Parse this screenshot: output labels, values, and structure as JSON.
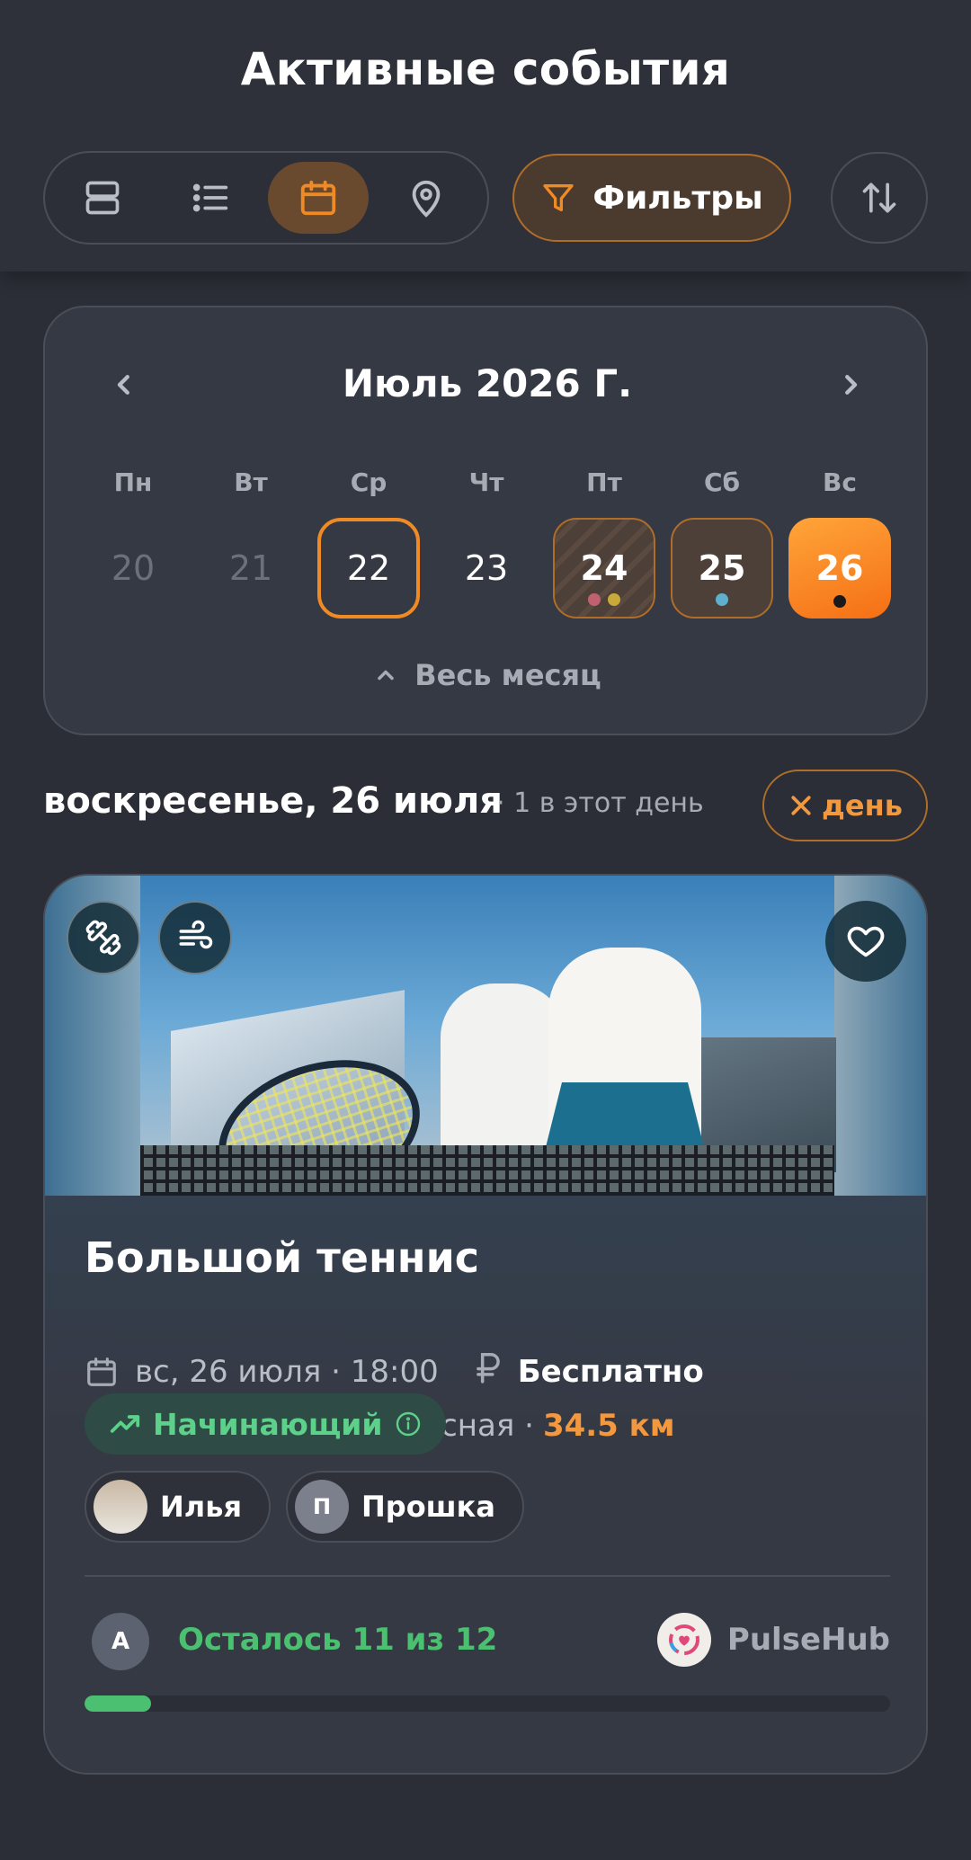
{
  "header": {
    "title": "Активные события",
    "views": [
      "cards-view-icon",
      "list-view-icon",
      "calendar-view-icon",
      "map-view-icon"
    ],
    "active_view": "calendar",
    "filters_label": "Фильтры",
    "accent_color": "#f08a24"
  },
  "calendar": {
    "month_label": "Июль 2026 Г.",
    "weekdays": [
      "Пн",
      "Вт",
      "Ср",
      "Чт",
      "Пт",
      "Сб",
      "Вс"
    ],
    "days": [
      {
        "label": "20",
        "state": "past"
      },
      {
        "label": "21",
        "state": "past"
      },
      {
        "label": "22",
        "state": "today"
      },
      {
        "label": "23",
        "state": "normal"
      },
      {
        "label": "24",
        "state": "has-events",
        "dots": [
          "#c0616f",
          "#c9a93a"
        ]
      },
      {
        "label": "25",
        "state": "has-events",
        "dots": [
          "#5fb0cf"
        ]
      },
      {
        "label": "26",
        "state": "selected",
        "dots": [
          "#1a1a1a"
        ]
      }
    ],
    "expand_label": "Весь месяц"
  },
  "day_section": {
    "heading": "воскресенье, 26 июля",
    "count": "· 1 в этот день",
    "clear_chip_label": "день"
  },
  "event": {
    "title": "Большой теннис",
    "datetime": "вс, 26 июля · 18:00",
    "price": "Бесплатно",
    "address": "г Троицк, ул Теннисная ·",
    "distance": "34.5 км",
    "level": "Начинающий",
    "participants": [
      {
        "name": "Илья",
        "initial": ""
      },
      {
        "name": "Прошка",
        "initial": "П"
      }
    ],
    "author_initial": "А",
    "spots_text": "Осталось 11 из 12",
    "spots_taken_fraction": 0.083,
    "organizer": "PulseHub"
  }
}
